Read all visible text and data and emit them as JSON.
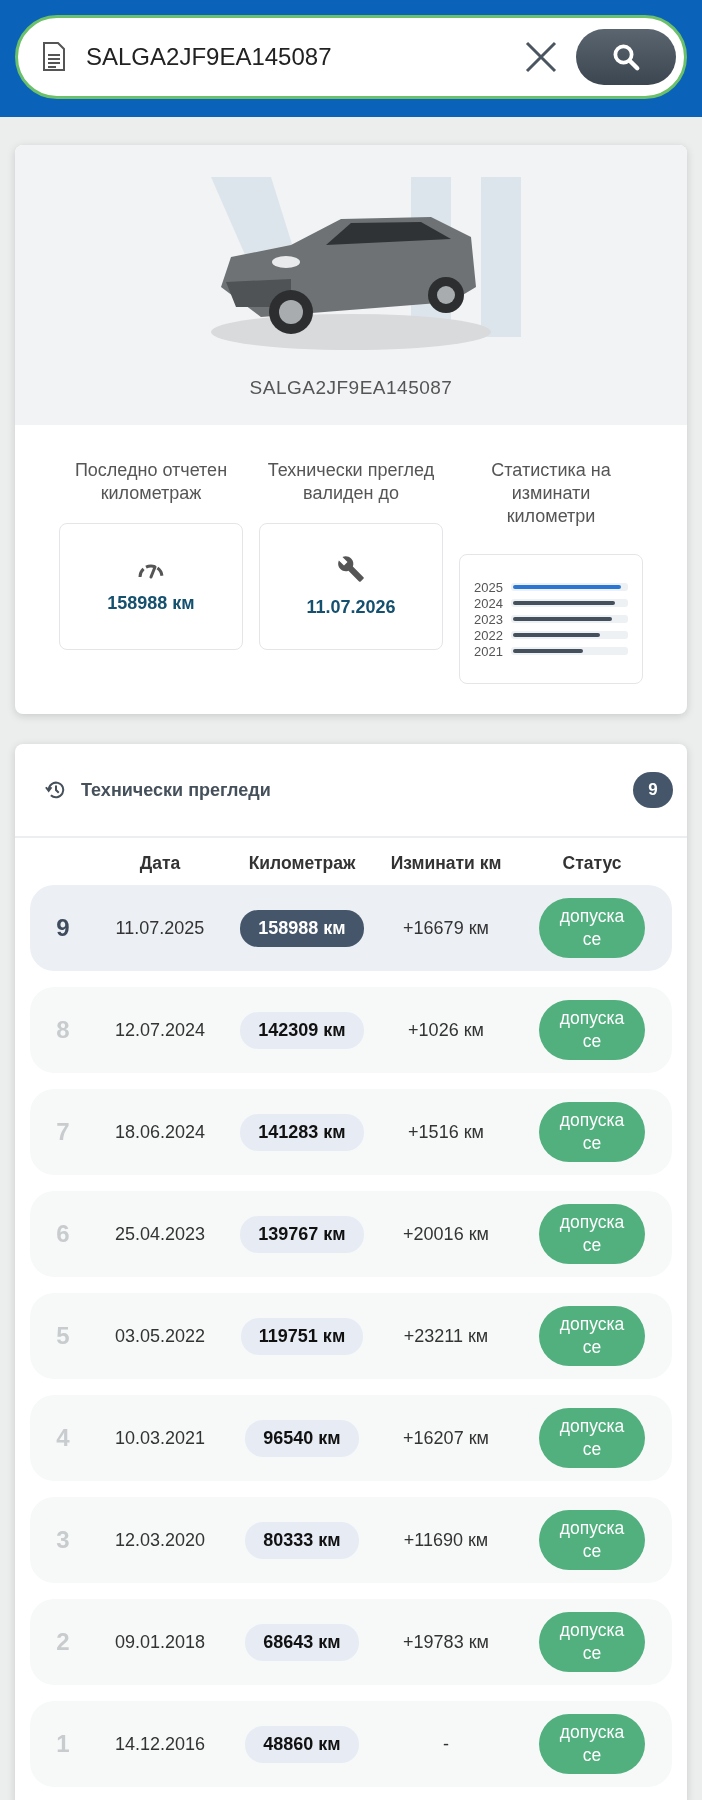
{
  "search": {
    "value": "SALGA2JF9EA145087"
  },
  "vehicle": {
    "vin": "SALGA2JF9EA145087"
  },
  "stats": [
    {
      "kind": "mileage",
      "label": "Последно отчетен километраж",
      "value": "158988 км"
    },
    {
      "kind": "inspection",
      "label": "Технически преглед валиден до",
      "value": "11.07.2026"
    },
    {
      "kind": "chart",
      "label": "Статистика на изминати километри",
      "years": [
        {
          "year": "2025",
          "level": 0.96,
          "selected": true
        },
        {
          "year": "2024",
          "level": 0.9,
          "selected": false
        },
        {
          "year": "2023",
          "level": 0.88,
          "selected": false
        },
        {
          "year": "2022",
          "level": 0.77,
          "selected": false
        },
        {
          "year": "2021",
          "level": 0.62,
          "selected": false
        }
      ]
    }
  ],
  "inspections": {
    "title": "Технически прегледи",
    "count": "9",
    "columns": [
      "Дата",
      "Километраж",
      "Изминати км",
      "Статус"
    ],
    "rows": [
      {
        "number": "9",
        "date": "11.07.2025",
        "mileage": "158988 км",
        "delta": "+16679 км",
        "status": "допуска се",
        "selected": true
      },
      {
        "number": "8",
        "date": "12.07.2024",
        "mileage": "142309 км",
        "delta": "+1026 км",
        "status": "допуска се",
        "selected": false
      },
      {
        "number": "7",
        "date": "18.06.2024",
        "mileage": "141283 км",
        "delta": "+1516 км",
        "status": "допуска се",
        "selected": false
      },
      {
        "number": "6",
        "date": "25.04.2023",
        "mileage": "139767 км",
        "delta": "+20016 км",
        "status": "допуска се",
        "selected": false
      },
      {
        "number": "5",
        "date": "03.05.2022",
        "mileage": "119751 км",
        "delta": "+23211 км",
        "status": "допуска се",
        "selected": false
      },
      {
        "number": "4",
        "date": "10.03.2021",
        "mileage": "96540 км",
        "delta": "+16207 км",
        "status": "допуска се",
        "selected": false
      },
      {
        "number": "3",
        "date": "12.03.2020",
        "mileage": "80333 км",
        "delta": "+11690 км",
        "status": "допуска се",
        "selected": false
      },
      {
        "number": "2",
        "date": "09.01.2018",
        "mileage": "68643 км",
        "delta": "+19783 км",
        "status": "допуска се",
        "selected": false
      },
      {
        "number": "1",
        "date": "14.12.2016",
        "mileage": "48860 км",
        "delta": "-",
        "status": "допуска се",
        "selected": false
      }
    ]
  }
}
